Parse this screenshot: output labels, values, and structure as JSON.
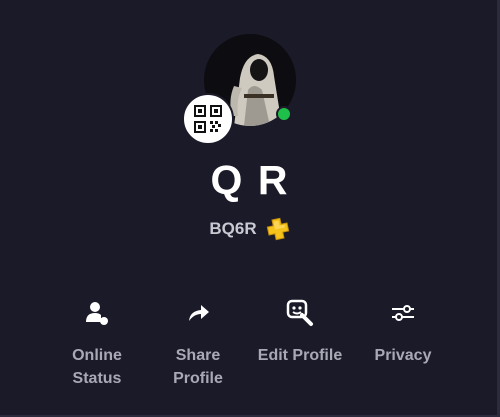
{
  "profile": {
    "display_name": "Q R",
    "online_id": "BQ6R",
    "online_status": "online",
    "status_color": "#1fc04a",
    "plus_badge_icon": "playstation-plus-icon",
    "plus_badge_color": "#f4c21a"
  },
  "icons": {
    "qr": "qr-code-icon",
    "online_status": "person-status-icon",
    "share": "share-arrow-icon",
    "edit": "edit-avatar-icon",
    "privacy": "sliders-icon"
  },
  "actions": {
    "online_status_label": "Online\nStatus",
    "share_profile_label": "Share\nProfile",
    "edit_profile_label": "Edit Profile",
    "privacy_label": "Privacy"
  }
}
